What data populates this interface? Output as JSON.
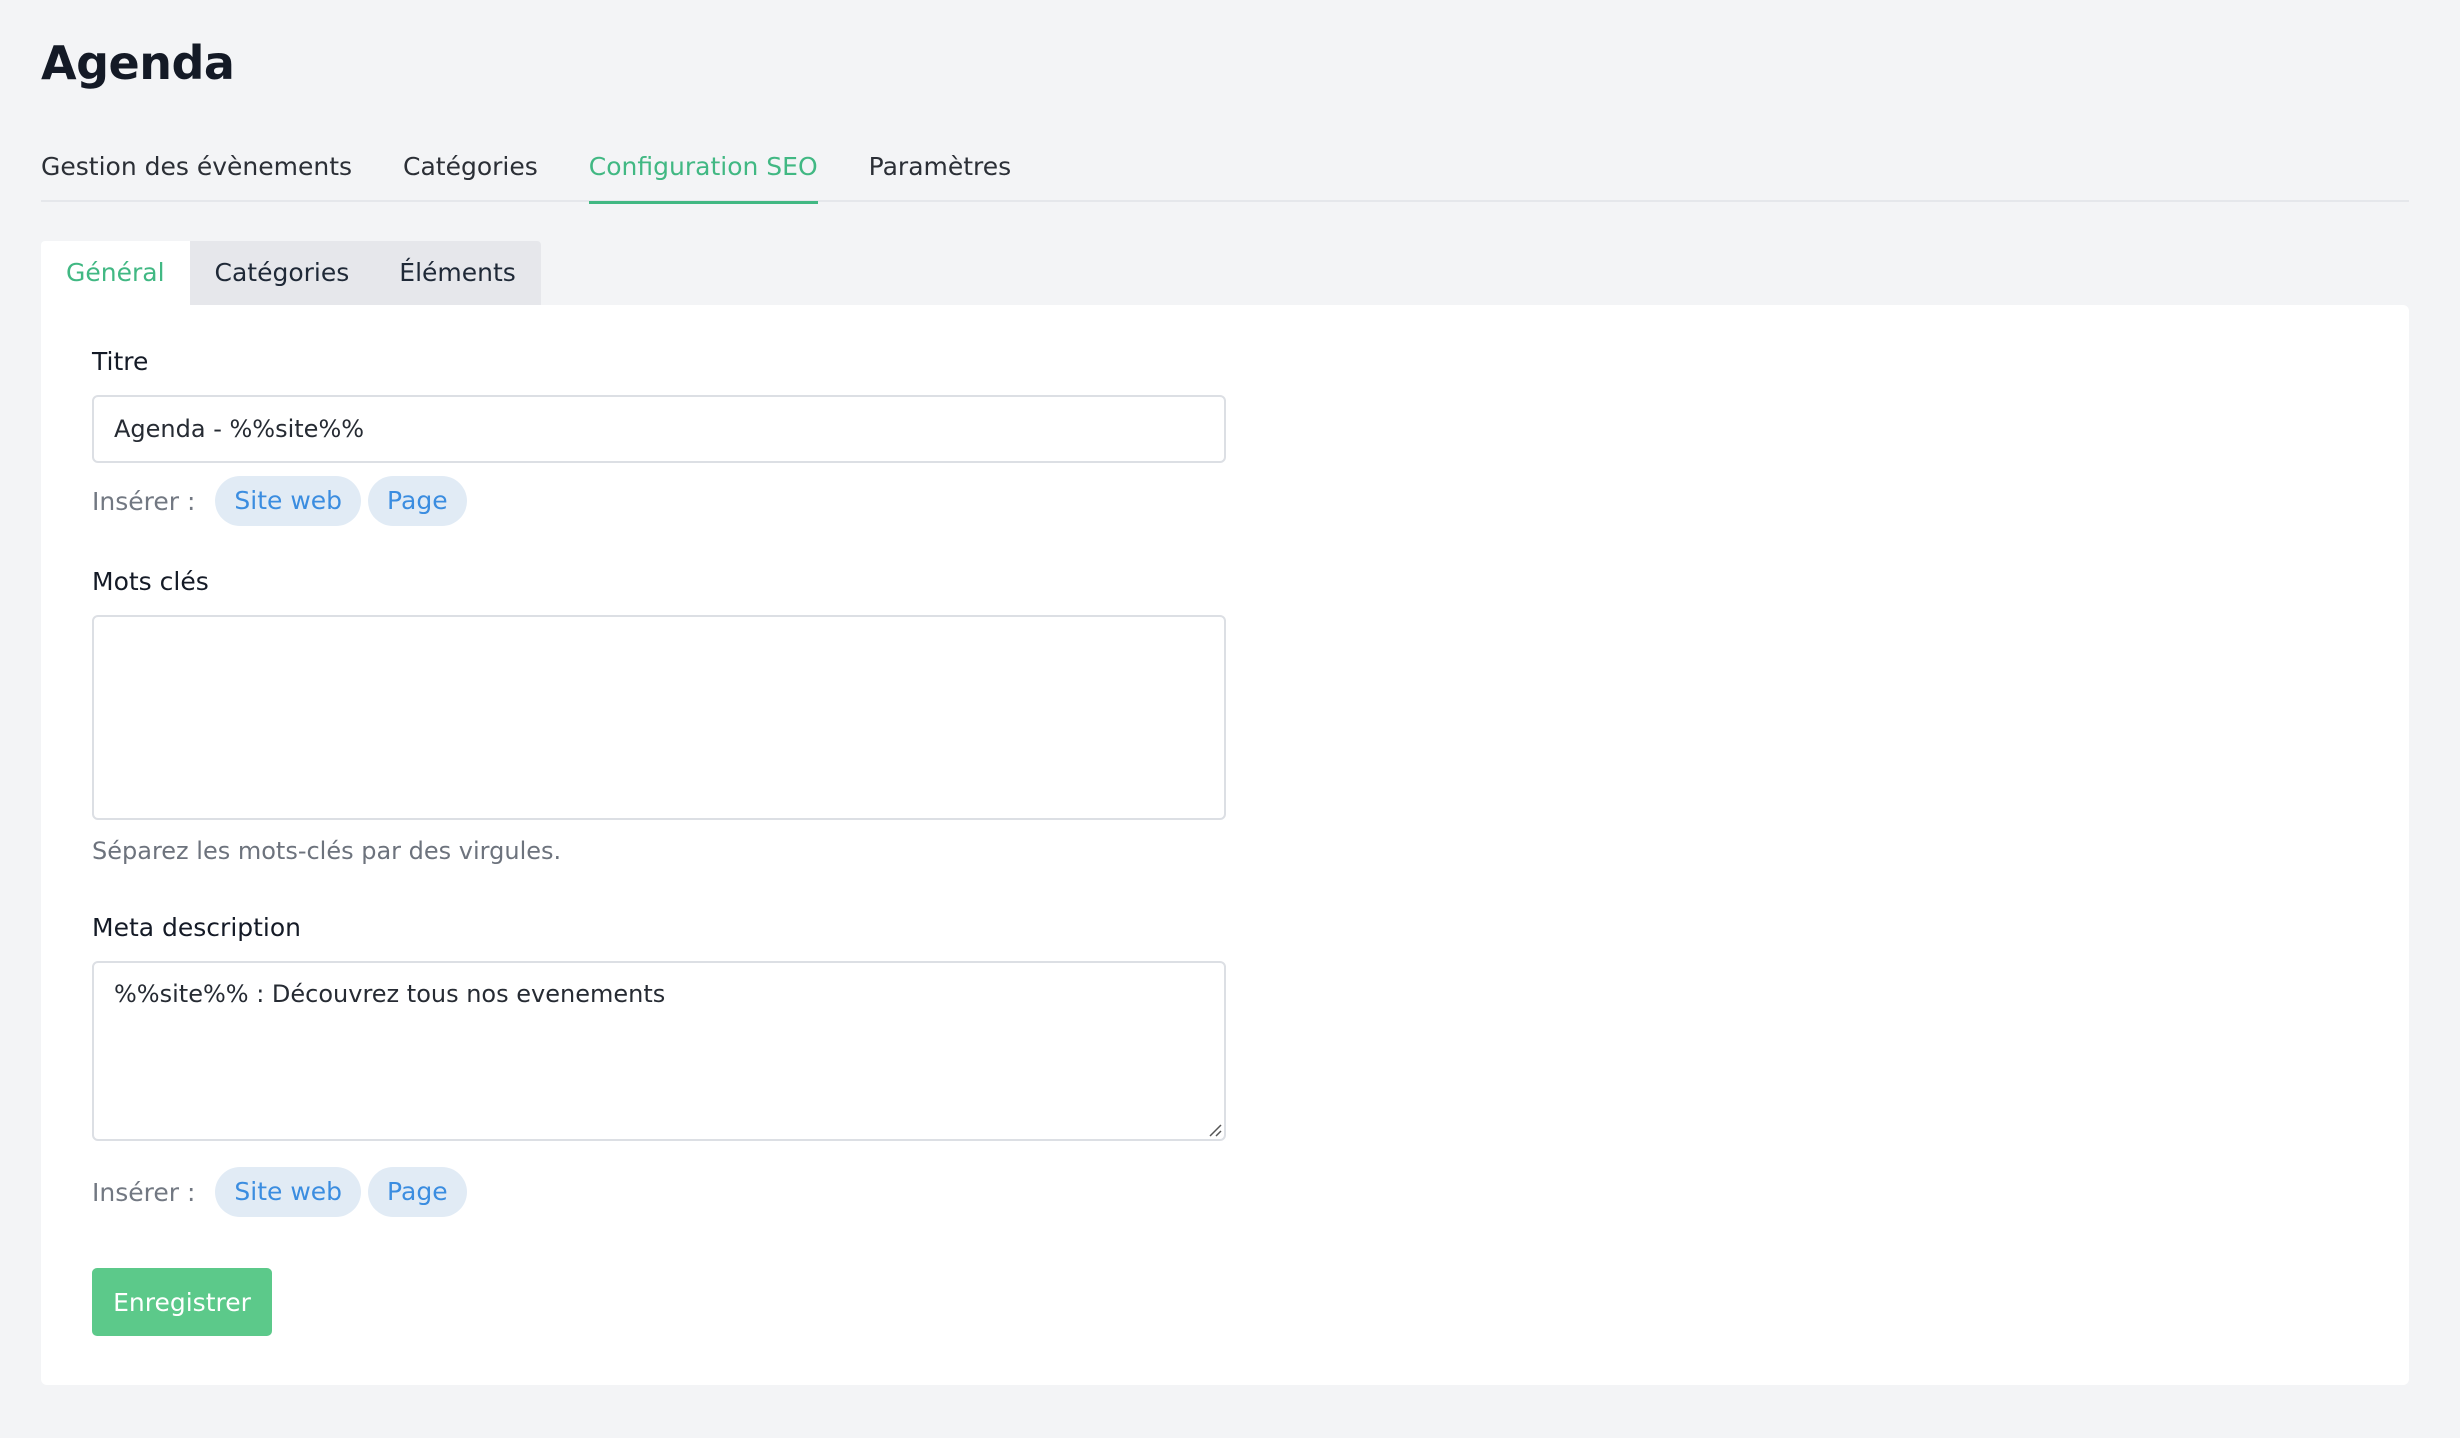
{
  "page": {
    "title": "Agenda"
  },
  "main_tabs": [
    {
      "label": "Gestion des évènements",
      "active": false
    },
    {
      "label": "Catégories",
      "active": false
    },
    {
      "label": "Configuration SEO",
      "active": true
    },
    {
      "label": "Paramètres",
      "active": false
    }
  ],
  "sub_tabs": [
    {
      "label": "Général",
      "active": true
    },
    {
      "label": "Catégories",
      "active": false
    },
    {
      "label": "Éléments",
      "active": false
    }
  ],
  "form": {
    "title_label": "Titre",
    "title_value": "Agenda - %%site%%",
    "title_insert": {
      "label": "Insérer :",
      "chips": [
        "Site web",
        "Page"
      ]
    },
    "keywords_label": "Mots clés",
    "keywords_value": "",
    "keywords_help": "Séparez les mots-clés par des virgules.",
    "meta_label": "Meta description",
    "meta_value": "%%site%% : Découvrez tous nos evenements",
    "meta_insert": {
      "label": "Insérer :",
      "chips": [
        "Site web",
        "Page"
      ]
    },
    "save_label": "Enregistrer"
  },
  "colors": {
    "accent": "#41b883",
    "button": "#5cc98a",
    "chip_text": "#3b8de0",
    "chip_bg": "#e1ebf5",
    "background": "#f3f4f6"
  }
}
